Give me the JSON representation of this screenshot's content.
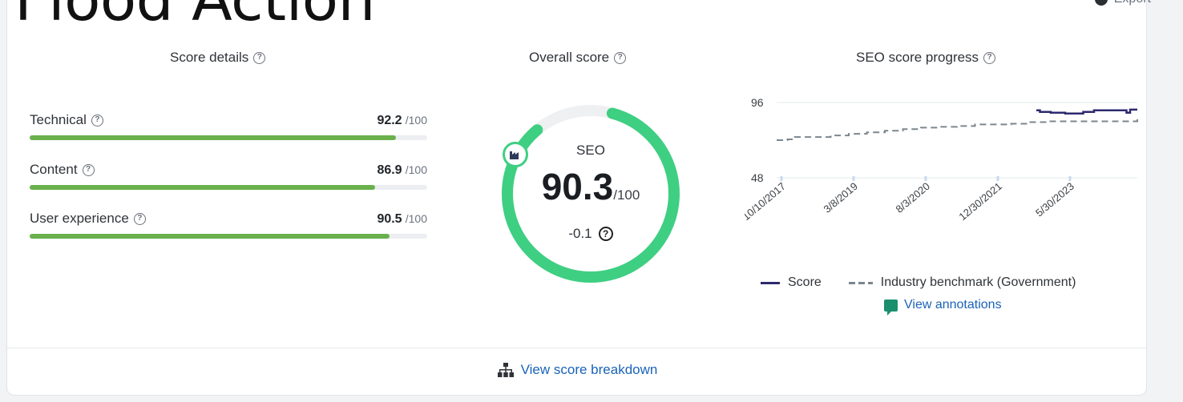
{
  "page": {
    "title": "Flood Action",
    "export_label": "Export"
  },
  "score_details": {
    "title": "Score details",
    "metrics": [
      {
        "label": "Technical",
        "score": "92.2",
        "max": "/100",
        "fraction": 0.922
      },
      {
        "label": "Content",
        "score": "86.9",
        "max": "/100",
        "fraction": 0.869
      },
      {
        "label": "User experience",
        "score": "90.5",
        "max": "/100",
        "fraction": 0.905
      }
    ]
  },
  "overall_score": {
    "title": "Overall score",
    "label": "SEO",
    "score": "90.3",
    "max": "/100",
    "delta": "-0.1",
    "fraction": 0.903
  },
  "progress": {
    "title": "SEO score progress",
    "legend_score": "Score",
    "legend_benchmark": "Industry benchmark (Government)",
    "view_annotations": "View annotations"
  },
  "chart_data": {
    "type": "line",
    "ylim": [
      48,
      96
    ],
    "yticks": [
      "96",
      "48"
    ],
    "xticks": [
      "10/10/2017",
      "3/8/2019",
      "8/3/2020",
      "12/30/2021",
      "5/30/2023"
    ],
    "series": [
      {
        "name": "Score",
        "points": [
          [
            0.72,
            91
          ],
          [
            0.73,
            90
          ],
          [
            0.76,
            89.5
          ],
          [
            0.8,
            89
          ],
          [
            0.84,
            89
          ],
          [
            0.85,
            90
          ],
          [
            0.88,
            91
          ],
          [
            0.92,
            91
          ],
          [
            0.96,
            91
          ],
          [
            0.97,
            89.5
          ],
          [
            0.98,
            91.5
          ],
          [
            1.0,
            91.5
          ]
        ]
      },
      {
        "name": "Industry benchmark (Government)",
        "points": [
          [
            0.0,
            72
          ],
          [
            0.03,
            72.5
          ],
          [
            0.05,
            74
          ],
          [
            0.1,
            74
          ],
          [
            0.15,
            75
          ],
          [
            0.2,
            76
          ],
          [
            0.25,
            77
          ],
          [
            0.3,
            78
          ],
          [
            0.35,
            79
          ],
          [
            0.4,
            80
          ],
          [
            0.45,
            80.5
          ],
          [
            0.5,
            81
          ],
          [
            0.55,
            82
          ],
          [
            0.6,
            82
          ],
          [
            0.65,
            82.5
          ],
          [
            0.7,
            83.5
          ],
          [
            0.75,
            84
          ],
          [
            0.8,
            84
          ],
          [
            0.85,
            84
          ],
          [
            0.9,
            84
          ],
          [
            0.95,
            84
          ],
          [
            0.98,
            84
          ],
          [
            1.0,
            87
          ]
        ]
      }
    ],
    "colors": {
      "score": "#2d2a6e",
      "benchmark": "#7c868e"
    }
  },
  "footer": {
    "breakdown_label": "View score breakdown"
  }
}
